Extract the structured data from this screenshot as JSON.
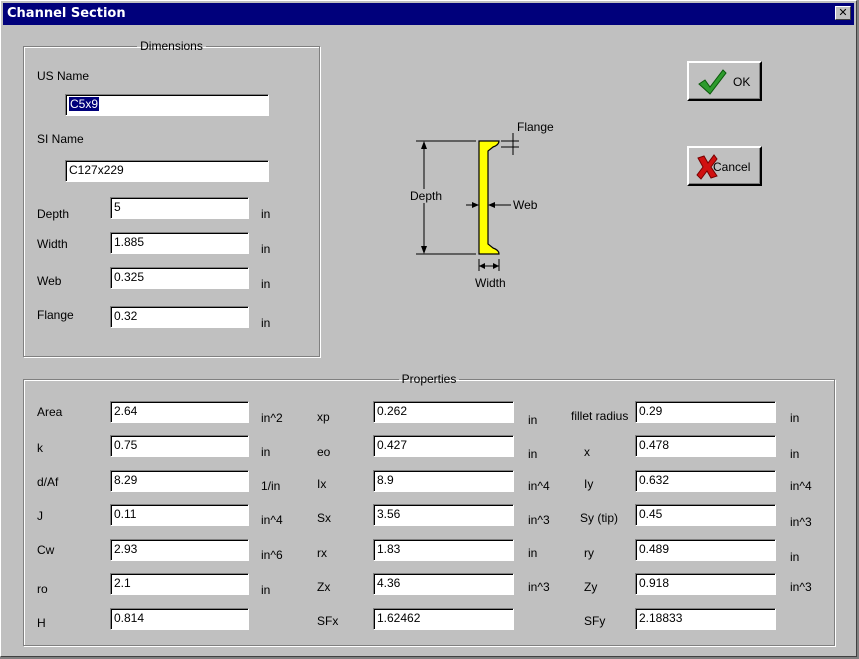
{
  "window": {
    "title": "Channel Section",
    "close_glyph": "✕"
  },
  "dimensions": {
    "legend": "Dimensions",
    "us_name_label": "US Name",
    "us_name_value": "C5x9",
    "si_name_label": "SI Name",
    "si_name_value": "C127x229",
    "rows": [
      {
        "label": "Depth",
        "value": "5",
        "unit": "in"
      },
      {
        "label": "Width",
        "value": "1.885",
        "unit": "in"
      },
      {
        "label": "Web",
        "value": "0.325",
        "unit": "in"
      },
      {
        "label": "Flange",
        "value": "0.32",
        "unit": "in"
      }
    ]
  },
  "diagram": {
    "flange": "Flange",
    "depth": "Depth",
    "web": "Web",
    "width": "Width",
    "shape_color": "#ffff00"
  },
  "buttons": {
    "ok": "OK",
    "cancel": "Cancel",
    "ok_icon": "checkmark-icon",
    "cancel_icon": "x-cancel-icon"
  },
  "properties": {
    "legend": "Properties",
    "col1": [
      {
        "label": "Area",
        "value": "2.64",
        "unit": "in^2"
      },
      {
        "label": "k",
        "value": "0.75",
        "unit": "in"
      },
      {
        "label": "d/Af",
        "value": "8.29",
        "unit": "1/in"
      },
      {
        "label": "J",
        "value": "0.11",
        "unit": "in^4"
      },
      {
        "label": "Cw",
        "value": "2.93",
        "unit": "in^6"
      },
      {
        "label": "ro",
        "value": "2.1",
        "unit": "in"
      },
      {
        "label": "H",
        "value": "0.814",
        "unit": ""
      }
    ],
    "col2": [
      {
        "label": "xp",
        "value": "0.262",
        "unit": "in"
      },
      {
        "label": "eo",
        "value": "0.427",
        "unit": "in"
      },
      {
        "label": "Ix",
        "value": "8.9",
        "unit": "in^4"
      },
      {
        "label": "Sx",
        "value": "3.56",
        "unit": "in^3"
      },
      {
        "label": "rx",
        "value": "1.83",
        "unit": "in"
      },
      {
        "label": "Zx",
        "value": "4.36",
        "unit": "in^3"
      },
      {
        "label": "SFx",
        "value": "1.62462",
        "unit": ""
      }
    ],
    "col3": [
      {
        "label": "fillet radius",
        "value": "0.29",
        "unit": "in"
      },
      {
        "label": "x",
        "value": "0.478",
        "unit": "in"
      },
      {
        "label": "Iy",
        "value": "0.632",
        "unit": "in^4"
      },
      {
        "label": "Sy (tip)",
        "value": "0.45",
        "unit": "in^3"
      },
      {
        "label": "ry",
        "value": "0.489",
        "unit": "in"
      },
      {
        "label": "Zy",
        "value": "0.918",
        "unit": "in^3"
      },
      {
        "label": "SFy",
        "value": "2.18833",
        "unit": ""
      }
    ]
  }
}
